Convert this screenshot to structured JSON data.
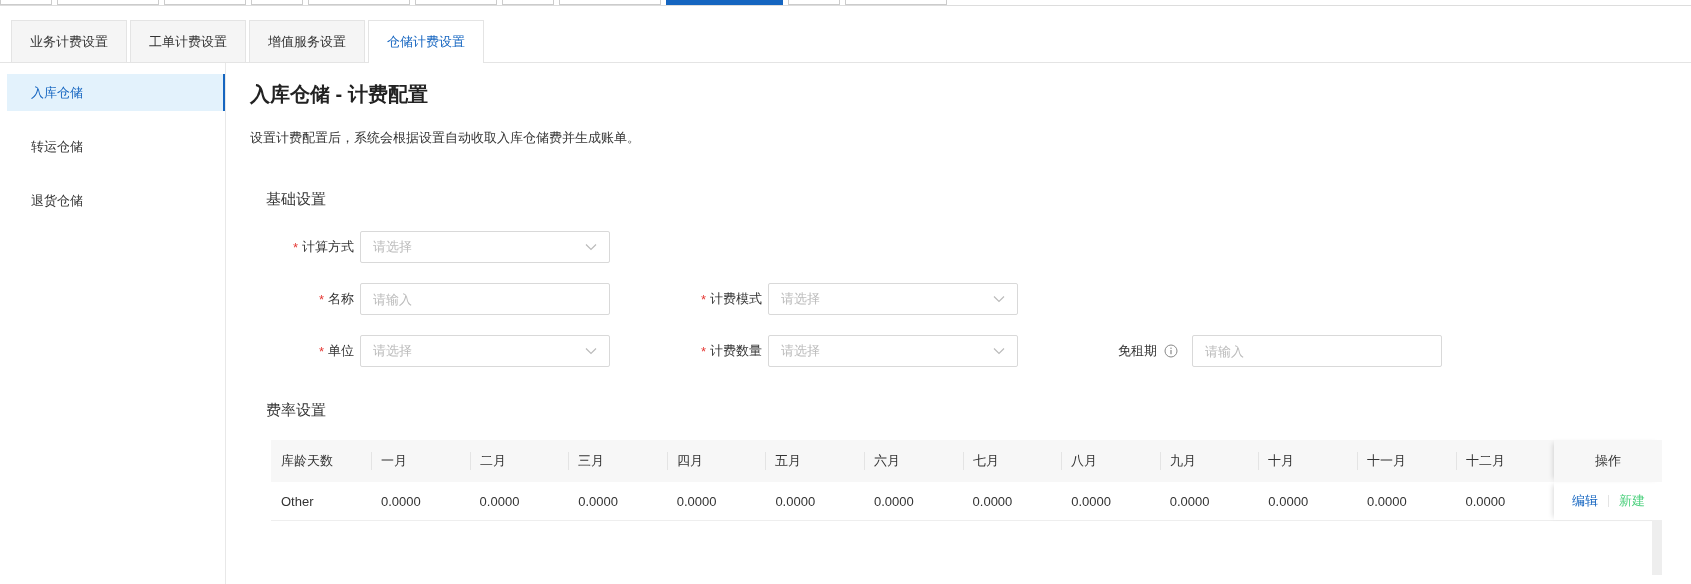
{
  "top_tabs": [
    {
      "selected": false
    },
    {
      "selected": false
    },
    {
      "selected": false
    },
    {
      "selected": false
    },
    {
      "selected": false
    },
    {
      "selected": false
    },
    {
      "selected": false
    },
    {
      "selected": false
    },
    {
      "selected": true
    },
    {
      "selected": false
    },
    {
      "selected": false
    }
  ],
  "tabs": [
    {
      "label": "业务计费设置",
      "selected": false
    },
    {
      "label": "工单计费设置",
      "selected": false
    },
    {
      "label": "增值服务设置",
      "selected": false
    },
    {
      "label": "仓储计费设置",
      "selected": true
    }
  ],
  "sidebar": {
    "items": [
      {
        "label": "入库仓储",
        "selected": true
      },
      {
        "label": "转运仓储",
        "selected": false
      },
      {
        "label": "退货仓储",
        "selected": false
      }
    ]
  },
  "title": "入库仓储 - 计费配置",
  "description": "设置计费配置后，系统会根据设置自动收取入库仓储费并生成账单。",
  "basic": {
    "heading": "基础设置",
    "rows": [
      [
        {
          "label": "计算方式",
          "required_mark": "*",
          "kind": "select",
          "placeholder": "请选择"
        }
      ],
      [
        {
          "label": "名称",
          "required_mark": "*",
          "kind": "input",
          "placeholder": "请输入"
        },
        {
          "label": "计费模式",
          "required_mark": "*",
          "kind": "select",
          "placeholder": "请选择"
        }
      ],
      [
        {
          "label": "单位",
          "required_mark": "*",
          "kind": "select",
          "placeholder": "请选择"
        },
        {
          "label": "计费数量",
          "required_mark": "*",
          "kind": "select",
          "placeholder": "请选择"
        },
        {
          "label": "免租期",
          "info": true,
          "kind": "input",
          "placeholder": "请输入"
        }
      ]
    ]
  },
  "rates": {
    "heading": "费率设置",
    "table": {
      "columns": [
        "库龄天数",
        "一月",
        "二月",
        "三月",
        "四月",
        "五月",
        "六月",
        "七月",
        "八月",
        "九月",
        "十月",
        "十一月",
        "十二月",
        "操作"
      ],
      "rows": [
        {
          "cells": [
            "Other",
            "0.0000",
            "0.0000",
            "0.0000",
            "0.0000",
            "0.0000",
            "0.0000",
            "0.0000",
            "0.0000",
            "0.0000",
            "0.0000",
            "0.0000",
            "0.0000"
          ],
          "actions": [
            "编辑",
            "新建"
          ]
        }
      ]
    }
  }
}
